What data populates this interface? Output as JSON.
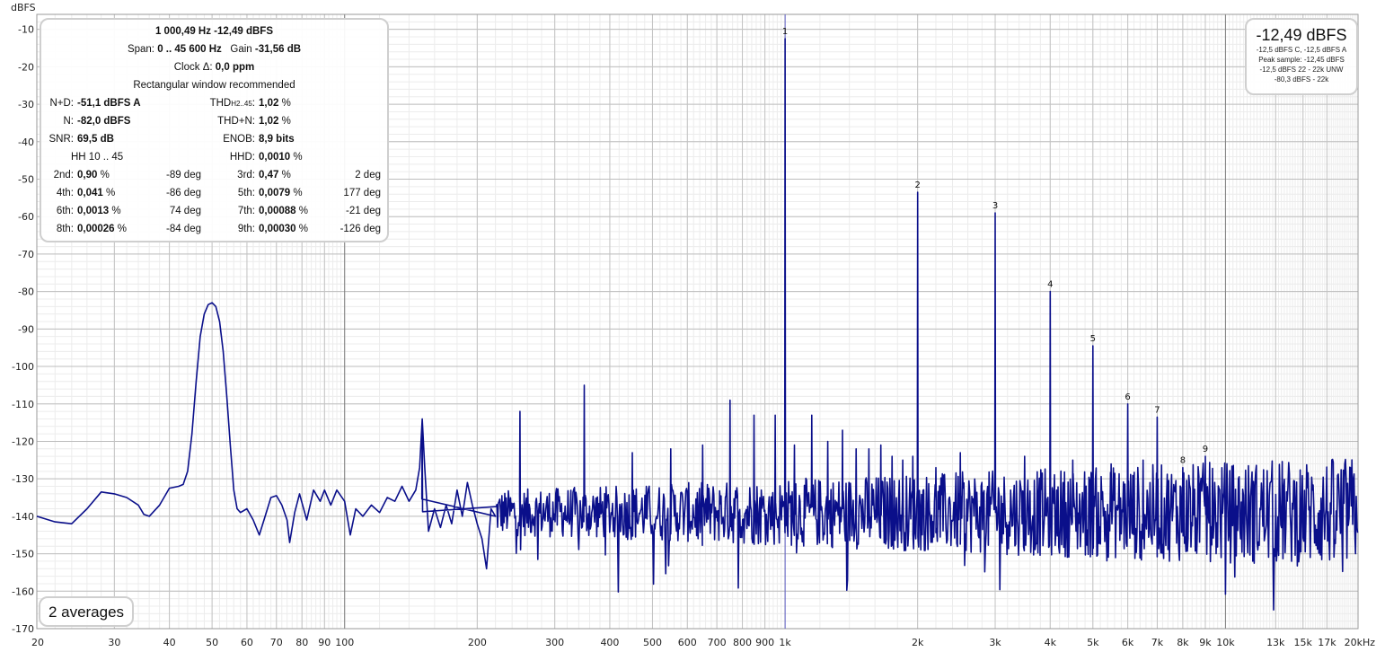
{
  "chart_data": {
    "type": "line",
    "xlabel": "",
    "ylabel": "dBFS",
    "x_scale": "log",
    "xlim": [
      20,
      20000
    ],
    "ylim": [
      -170,
      -6
    ],
    "grid": true,
    "yticks": [
      -10,
      -20,
      -30,
      -40,
      -50,
      -60,
      -70,
      -80,
      -90,
      -100,
      -110,
      -120,
      -130,
      -140,
      -150,
      -160,
      -170
    ],
    "xticks": [
      {
        "f": 20,
        "label": "20"
      },
      {
        "f": 30,
        "label": "30"
      },
      {
        "f": 40,
        "label": "40"
      },
      {
        "f": 50,
        "label": "50"
      },
      {
        "f": 60,
        "label": "60"
      },
      {
        "f": 70,
        "label": "70"
      },
      {
        "f": 80,
        "label": "80"
      },
      {
        "f": 90,
        "label": "90"
      },
      {
        "f": 100,
        "label": "100"
      },
      {
        "f": 200,
        "label": "200"
      },
      {
        "f": 300,
        "label": "300"
      },
      {
        "f": 400,
        "label": "400"
      },
      {
        "f": 500,
        "label": "500"
      },
      {
        "f": 600,
        "label": "600"
      },
      {
        "f": 700,
        "label": "700"
      },
      {
        "f": 800,
        "label": "800"
      },
      {
        "f": 900,
        "label": "900"
      },
      {
        "f": 1000,
        "label": "1k"
      },
      {
        "f": 2000,
        "label": "2k"
      },
      {
        "f": 3000,
        "label": "3k"
      },
      {
        "f": 4000,
        "label": "4k"
      },
      {
        "f": 5000,
        "label": "5k"
      },
      {
        "f": 6000,
        "label": "6k"
      },
      {
        "f": 7000,
        "label": "7k"
      },
      {
        "f": 8000,
        "label": "8k"
      },
      {
        "f": 9000,
        "label": "9k"
      },
      {
        "f": 10000,
        "label": "10k"
      },
      {
        "f": 13000,
        "label": "13k"
      },
      {
        "f": 15000,
        "label": "15k"
      },
      {
        "f": 17000,
        "label": "17k"
      },
      {
        "f": 20000,
        "label": "20kHz"
      }
    ],
    "harmonics": [
      {
        "n": "1",
        "f": 1000,
        "db": -12.5
      },
      {
        "n": "2",
        "f": 2000,
        "db": -53.5
      },
      {
        "n": "3",
        "f": 3000,
        "db": -59
      },
      {
        "n": "4",
        "f": 4000,
        "db": -80
      },
      {
        "n": "5",
        "f": 5000,
        "db": -94.5
      },
      {
        "n": "6",
        "f": 6000,
        "db": -110
      },
      {
        "n": "7",
        "f": 7000,
        "db": -113.5
      },
      {
        "n": "8",
        "f": 8000,
        "db": -127
      },
      {
        "n": "9",
        "f": 9000,
        "db": -124
      }
    ],
    "spurs": [
      {
        "f": 150,
        "db": -114
      },
      {
        "f": 250,
        "db": -112
      },
      {
        "f": 350,
        "db": -105
      },
      {
        "f": 450,
        "db": -123
      },
      {
        "f": 550,
        "db": -122
      },
      {
        "f": 650,
        "db": -121
      },
      {
        "f": 750,
        "db": -109
      },
      {
        "f": 850,
        "db": -113
      },
      {
        "f": 950,
        "db": -113
      },
      {
        "f": 1050,
        "db": -121
      },
      {
        "f": 1150,
        "db": -113
      },
      {
        "f": 1250,
        "db": -120
      },
      {
        "f": 1350,
        "db": -117
      },
      {
        "f": 1450,
        "db": -122
      },
      {
        "f": 1550,
        "db": -122
      },
      {
        "f": 1650,
        "db": -121
      },
      {
        "f": 1750,
        "db": -124
      },
      {
        "f": 1850,
        "db": -125
      },
      {
        "f": 1950,
        "db": -124
      },
      {
        "f": 2200,
        "db": -127
      },
      {
        "f": 2500,
        "db": -123
      },
      {
        "f": 3500,
        "db": -124
      },
      {
        "f": 4500,
        "db": -125
      },
      {
        "f": 5500,
        "db": -126
      },
      {
        "f": 6500,
        "db": -125
      }
    ],
    "low_band": [
      [
        20,
        -140
      ],
      [
        22,
        -141.5
      ],
      [
        24,
        -142
      ],
      [
        26,
        -138
      ],
      [
        28,
        -133.5
      ],
      [
        30,
        -134
      ],
      [
        32,
        -135
      ],
      [
        34,
        -137
      ],
      [
        35,
        -139.5
      ],
      [
        36,
        -140
      ],
      [
        38,
        -137
      ],
      [
        40,
        -132.5
      ],
      [
        42,
        -132
      ],
      [
        43,
        -131.5
      ],
      [
        44,
        -128
      ],
      [
        45,
        -118
      ],
      [
        46,
        -104
      ],
      [
        47,
        -92
      ],
      [
        48,
        -86
      ],
      [
        49,
        -83.5
      ],
      [
        50,
        -83
      ],
      [
        51,
        -84
      ],
      [
        52,
        -88
      ],
      [
        53,
        -96
      ],
      [
        54,
        -108
      ],
      [
        55,
        -121
      ],
      [
        56,
        -133
      ],
      [
        57,
        -138
      ],
      [
        58,
        -139
      ],
      [
        60,
        -138
      ],
      [
        62,
        -141
      ],
      [
        64,
        -145
      ],
      [
        66,
        -140
      ],
      [
        68,
        -135
      ],
      [
        70,
        -134.5
      ],
      [
        72,
        -137
      ],
      [
        74,
        -141
      ],
      [
        75,
        -147
      ],
      [
        77,
        -139
      ],
      [
        79,
        -134
      ],
      [
        82,
        -141
      ],
      [
        85,
        -133
      ],
      [
        88,
        -136
      ],
      [
        90,
        -133
      ],
      [
        93,
        -137
      ],
      [
        96,
        -133
      ],
      [
        100,
        -136
      ],
      [
        103,
        -145
      ],
      [
        106,
        -138
      ],
      [
        110,
        -140
      ],
      [
        115,
        -137
      ],
      [
        120,
        -139
      ],
      [
        125,
        -135
      ],
      [
        130,
        -136
      ],
      [
        135,
        -132
      ],
      [
        140,
        -136
      ],
      [
        145,
        -133
      ],
      [
        148,
        -127
      ],
      [
        150,
        -114
      ],
      [
        152,
        -127
      ],
      [
        155,
        -144
      ],
      [
        160,
        -138
      ],
      [
        165,
        -143
      ],
      [
        170,
        -137
      ],
      [
        175,
        -142
      ],
      [
        180,
        -133
      ],
      [
        185,
        -140
      ],
      [
        190,
        -131
      ],
      [
        195,
        -137
      ],
      [
        200,
        -142
      ],
      [
        205,
        -146
      ],
      [
        210,
        -154
      ],
      [
        215,
        -138
      ],
      [
        220,
        -140
      ]
    ]
  },
  "stats": {
    "line1": "1 000,49 Hz  -12,49 dBFS",
    "span_label": "Span: ",
    "span_value": "0 .. 45 600 Hz",
    "gain_label": "Gain ",
    "gain_value": "-31,56 dB",
    "clock_label": "Clock Δ: ",
    "clock_value": "0,0 ppm",
    "window_note": "Rectangular window recommended",
    "nd_label": "N+D:",
    "nd_value": "-51,1 dBFS A",
    "thd_label": "THD",
    "thd_sub": "H2..45",
    "thd_colon": ":",
    "thd_value": "1,02",
    "n_label": "N:",
    "n_value": "-82,0 dBFS",
    "thdn_label": "THD+N:",
    "thdn_value": "1,02",
    "snr_label": "SNR:",
    "snr_value": "69,5 dB",
    "enob_label": "ENOB:",
    "enob_value": "8,9 bits",
    "hh_label": "HH 10 .. 45",
    "hhd_label": "HHD:",
    "hhd_value": "0,0010",
    "pct": "%",
    "harm_rows": [
      [
        {
          "label": "2nd:",
          "value": "0,90",
          "phase": "-89 deg"
        },
        {
          "label": "3rd:",
          "value": "0,47",
          "phase": "2 deg"
        }
      ],
      [
        {
          "label": "4th:",
          "value": "0,041",
          "phase": "-86 deg"
        },
        {
          "label": "5th:",
          "value": "0,0079",
          "phase": "177 deg"
        }
      ],
      [
        {
          "label": "6th:",
          "value": "0,0013",
          "phase": "74 deg"
        },
        {
          "label": "7th:",
          "value": "0,00088",
          "phase": "-21 deg"
        }
      ],
      [
        {
          "label": "8th:",
          "value": "0,00026",
          "phase": "-84 deg"
        },
        {
          "label": "9th:",
          "value": "0,00030",
          "phase": "-126 deg"
        }
      ]
    ]
  },
  "level": {
    "big": "-12,49 dBFS",
    "lines": [
      "-12,5 dBFS C, -12,5 dBFS A",
      "Peak sample: -12,45 dBFS",
      "-12,5 dBFS 22 - 22k UNW",
      "-80,3 dBFS - 22k"
    ]
  },
  "averages": "2 averages",
  "colors": {
    "trace": "#0a0f8a",
    "grid_major": "#a9a9a9",
    "grid_minor": "#e6e6e6",
    "marker": "#6a6acf"
  }
}
